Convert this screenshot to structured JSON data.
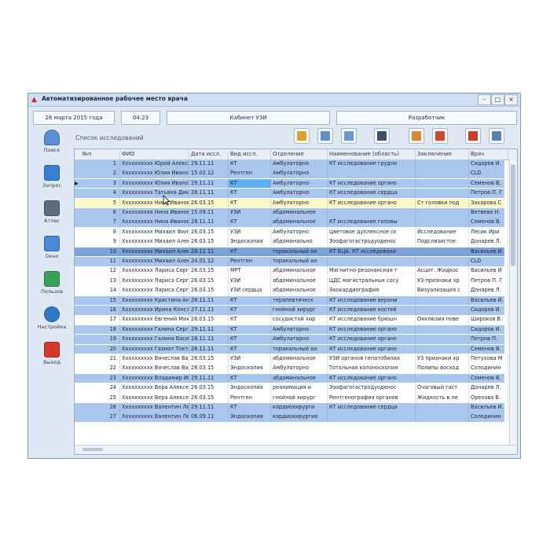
{
  "window": {
    "title": "Автоматизированное рабочее место врача",
    "controls": [
      "–",
      "□",
      "×"
    ]
  },
  "topbar": {
    "date": "26 марта 2015 года",
    "time": "04:23",
    "cabinet": "Кабинет УЗИ",
    "user": "Разработчик"
  },
  "sidebar": {
    "items": [
      {
        "label": "Поиск",
        "icon": "person-search-icon",
        "color": "#5a8fd6"
      },
      {
        "label": "Запрос",
        "icon": "query-icon",
        "color": "#3a7fd0"
      },
      {
        "label": "Атлас",
        "icon": "atlas-icon",
        "color": "#5d6c7d"
      },
      {
        "label": "Окно",
        "icon": "window-icon",
        "color": "#4a8ad8"
      },
      {
        "label": "Пользов",
        "icon": "users-icon",
        "color": "#3aa05a"
      },
      {
        "label": "Настройка",
        "icon": "gear-icon",
        "color": "#2f78c8"
      },
      {
        "label": "Выход",
        "icon": "exit-icon",
        "color": "#d8382a"
      }
    ]
  },
  "section_title": "Список исследований",
  "toolbar": {
    "buttons": [
      {
        "icon": "chart-icon",
        "color": "#d9a02a"
      },
      {
        "icon": "table-icon",
        "color": "#5d8fd0"
      },
      {
        "icon": "document-icon",
        "color": "#6a98cc"
      },
      {
        "icon": "monitor-icon",
        "color": "#3d4f66"
      },
      {
        "icon": "edit-document-icon",
        "color": "#d98a2a"
      },
      {
        "icon": "tasks-icon",
        "color": "#c9472a"
      },
      {
        "icon": "print-icon",
        "color": "#c8402a"
      },
      {
        "icon": "pencil-icon",
        "color": "#5a7fb0"
      }
    ]
  },
  "table": {
    "columns": [
      "№п",
      "ФИО",
      "Дата иссл.",
      "Вид иссл.",
      "Отделение",
      "Наименование (область)",
      "Заключение",
      "Врач"
    ],
    "rows": [
      {
        "num": "1",
        "fio": "Хххххххххх Юрий Александр",
        "date": "29.11.11",
        "kind": "КТ",
        "dept": "Амбулаторно",
        "name": "КТ исследование грудно",
        "concl": "",
        "doctor": "Сидоров И.",
        "style": "blue"
      },
      {
        "num": "2",
        "fio": "Хххххххххх Юлия Ивановна",
        "date": "15.02.12",
        "kind": "Рентген",
        "dept": "Амбулаторно",
        "name": "",
        "concl": "",
        "doctor": "CLD",
        "style": "blue"
      },
      {
        "num": "3",
        "fio": "Хххххххххх Юлия Ивановна",
        "date": "29.11.11",
        "kind": "КТ",
        "dept": "Амбулаторно",
        "name": "КТ исследование органо",
        "concl": "",
        "doctor": "Семенов В.",
        "style": "blue",
        "marker": "▶"
      },
      {
        "num": "4",
        "fio": "Хххххххххх Татьяна Дмитри",
        "date": "28.11.11",
        "kind": "КТ",
        "dept": "Амбулаторно",
        "name": "КТ исследование сердца",
        "concl": "",
        "doctor": "Петров П. Г",
        "style": "blue"
      },
      {
        "num": "5",
        "fio": "Хххххххххх Нина Ивановна",
        "date": "26.03.15",
        "kind": "КТ",
        "dept": "Амбулаторно",
        "name": "КТ исследование органо",
        "concl": "Ст головки под",
        "doctor": "Захарова С",
        "style": "yellow"
      },
      {
        "num": "6",
        "fio": "Хххххххххх Нина Ивановна",
        "date": "15.09.11",
        "kind": "УЗИ",
        "dept": "абдоминальное",
        "name": "",
        "concl": "",
        "doctor": "Ветвева Н.",
        "style": "blue"
      },
      {
        "num": "7",
        "fio": "Хххххххххх Нина Ивановна",
        "date": "28.11.11",
        "kind": "КТ",
        "dept": "абдоминальное",
        "name": "КТ исследование головы",
        "concl": "",
        "doctor": "Семенов В.",
        "style": "blue"
      },
      {
        "num": "8",
        "fio": "Хххххххххх Михаил Филиппо",
        "date": "26.03.15",
        "kind": "УЗИ",
        "dept": "Амбулаторно",
        "name": "Цветовое дуплексное ск",
        "concl": "Исследование",
        "doctor": "Лесик Ири",
        "style": "white"
      },
      {
        "num": "9",
        "fio": "Хххххххххх Михаил Алексан",
        "date": "26.03.15",
        "kind": "Эндоскопия",
        "dept": "абдоминально",
        "name": "Эзофагогастродуоденос",
        "concl": "Подслизистое",
        "doctor": "Донарев Л.",
        "style": "white"
      },
      {
        "num": "10",
        "fio": "Хххххххххх Михаил Алексан",
        "date": "28.11.11",
        "kind": "КТ",
        "dept": "торакальный хи",
        "name": "КТ БЦА. КТ исследовани",
        "concl": "",
        "doctor": "Васильев И.",
        "style": "selected"
      },
      {
        "num": "11",
        "fio": "Хххххххххх Михаил Алексан",
        "date": "24.01.12",
        "kind": "Рентген",
        "dept": "торакальный хи",
        "name": "",
        "concl": "",
        "doctor": "CLD",
        "style": "blue"
      },
      {
        "num": "12",
        "fio": "Хххххххххх Лариса Сергеев",
        "date": "26.03.15",
        "kind": "МРТ",
        "dept": "абдоминальное",
        "name": "Магнитно-резонансная т",
        "concl": "Асцит. Жидкос",
        "doctor": "Васильев И",
        "style": "white"
      },
      {
        "num": "13",
        "fio": "Хххххххххх Лариса Сергеев",
        "date": "26.03.15",
        "kind": "УЗИ",
        "dept": "абдоминальное",
        "name": "ЦДС магистральных сосу",
        "concl": "УЗ-признаки хр",
        "doctor": "Петров П. Г",
        "style": "white"
      },
      {
        "num": "14",
        "fio": "Хххххххххх Лариса Сергеев",
        "date": "26.03.15",
        "kind": "УЗИ сердца",
        "dept": "абдоминальное",
        "name": "Эхокардиография",
        "concl": "Визуализация с",
        "doctor": "Донарев Л.",
        "style": "white"
      },
      {
        "num": "15",
        "fio": "Хххххххххх Кристина Андре",
        "date": "28.11.11",
        "kind": "КТ",
        "dept": "терапевтическ",
        "name": "КТ исследование верхни",
        "concl": "",
        "doctor": "Васильев И.",
        "style": "blue"
      },
      {
        "num": "16",
        "fio": "Хххххххххх Ирина Констант",
        "date": "27.11.11",
        "kind": "КТ",
        "dept": "гнойной хирург",
        "name": "КТ исследование костей",
        "concl": "",
        "doctor": "Сидоров И.",
        "style": "blue"
      },
      {
        "num": "17",
        "fio": "Хххххххххх Евгений Михайл",
        "date": "26.03.15",
        "kind": "КТ",
        "dept": "сосудистой хир",
        "name": "КТ исследование брюшн",
        "concl": "Окклюзия пове",
        "doctor": "Широков В.",
        "style": "white"
      },
      {
        "num": "18",
        "fio": "Хххххххххх Галина Сергеев",
        "date": "29.11.11",
        "kind": "КТ",
        "dept": "Амбулаторно",
        "name": "КТ исследование органо",
        "concl": "",
        "doctor": "Сидоров И.",
        "style": "blue"
      },
      {
        "num": "19",
        "fio": "Хххххххххх Галина Васильев",
        "date": "28.11.11",
        "kind": "КТ",
        "dept": "Амбулаторно",
        "name": "КТ исследование органо",
        "concl": "",
        "doctor": "Петров П.",
        "style": "blue"
      },
      {
        "num": "20",
        "fio": "Хххххххххх Газмат Токтаров",
        "date": "28.11.11",
        "kind": "КТ",
        "dept": "торакальный хи",
        "name": "КТ исследование органо",
        "concl": "",
        "doctor": "Семенов В.",
        "style": "blue"
      },
      {
        "num": "21",
        "fio": "Хххххххххх Вячеслав Васил",
        "date": "26.03.15",
        "kind": "УЗИ",
        "dept": "абдоминальное",
        "name": "УЗИ органов гепатобилиа",
        "concl": "УЗ признаки хр",
        "doctor": "Петухова М",
        "style": "white"
      },
      {
        "num": "22",
        "fio": "Хххххххххх Вячеслав Васил",
        "date": "26.03.15",
        "kind": "Эндоскопия",
        "dept": "Амбулаторно",
        "name": "Тотальная колоноскопия",
        "concl": "Полипы восход",
        "doctor": "Солодинин",
        "style": "white"
      },
      {
        "num": "23",
        "fio": "Хххххххххх Владимир Иванов",
        "date": "29.11.11",
        "kind": "КТ",
        "dept": "абдоминальное",
        "name": "КТ исследование органо",
        "concl": "",
        "doctor": "Семенов В.",
        "style": "blue"
      },
      {
        "num": "24",
        "fio": "Хххххххххх Вера Алексеевн",
        "date": "26.03.15",
        "kind": "Эндоскопия",
        "dept": "реанимация и",
        "name": "Эзофагогастродуоденос",
        "concl": "Очаговый гаст",
        "doctor": "Донарев Л.",
        "style": "white"
      },
      {
        "num": "25",
        "fio": "Хххххххххх Вера Алексеевн",
        "date": "26.03.15",
        "kind": "Рентген",
        "dept": "гнойной хирург",
        "name": "Рентгенография органов",
        "concl": "Жидкость в ле",
        "doctor": "Орехова В.",
        "style": "white"
      },
      {
        "num": "26",
        "fio": "Хххххххххх Валентин Леони",
        "date": "29.11.11",
        "kind": "КТ",
        "dept": "кардиохирурги",
        "name": "КТ исследование сердца",
        "concl": "",
        "doctor": "Васильев И.",
        "style": "blue"
      },
      {
        "num": "27",
        "fio": "Хххххххххх Валентин Леони",
        "date": "06.09.11",
        "kind": "Эндоскопия",
        "dept": "кардиохирургия",
        "name": "",
        "concl": "",
        "doctor": "Солодинин",
        "style": "blue"
      }
    ]
  },
  "row_colors": {
    "blue": "#a9c6ec",
    "white": "#ffffff",
    "yellow": "#fdf6c8",
    "selected": "#7ea3d8",
    "kind_highlight": "#5fb0f0"
  }
}
